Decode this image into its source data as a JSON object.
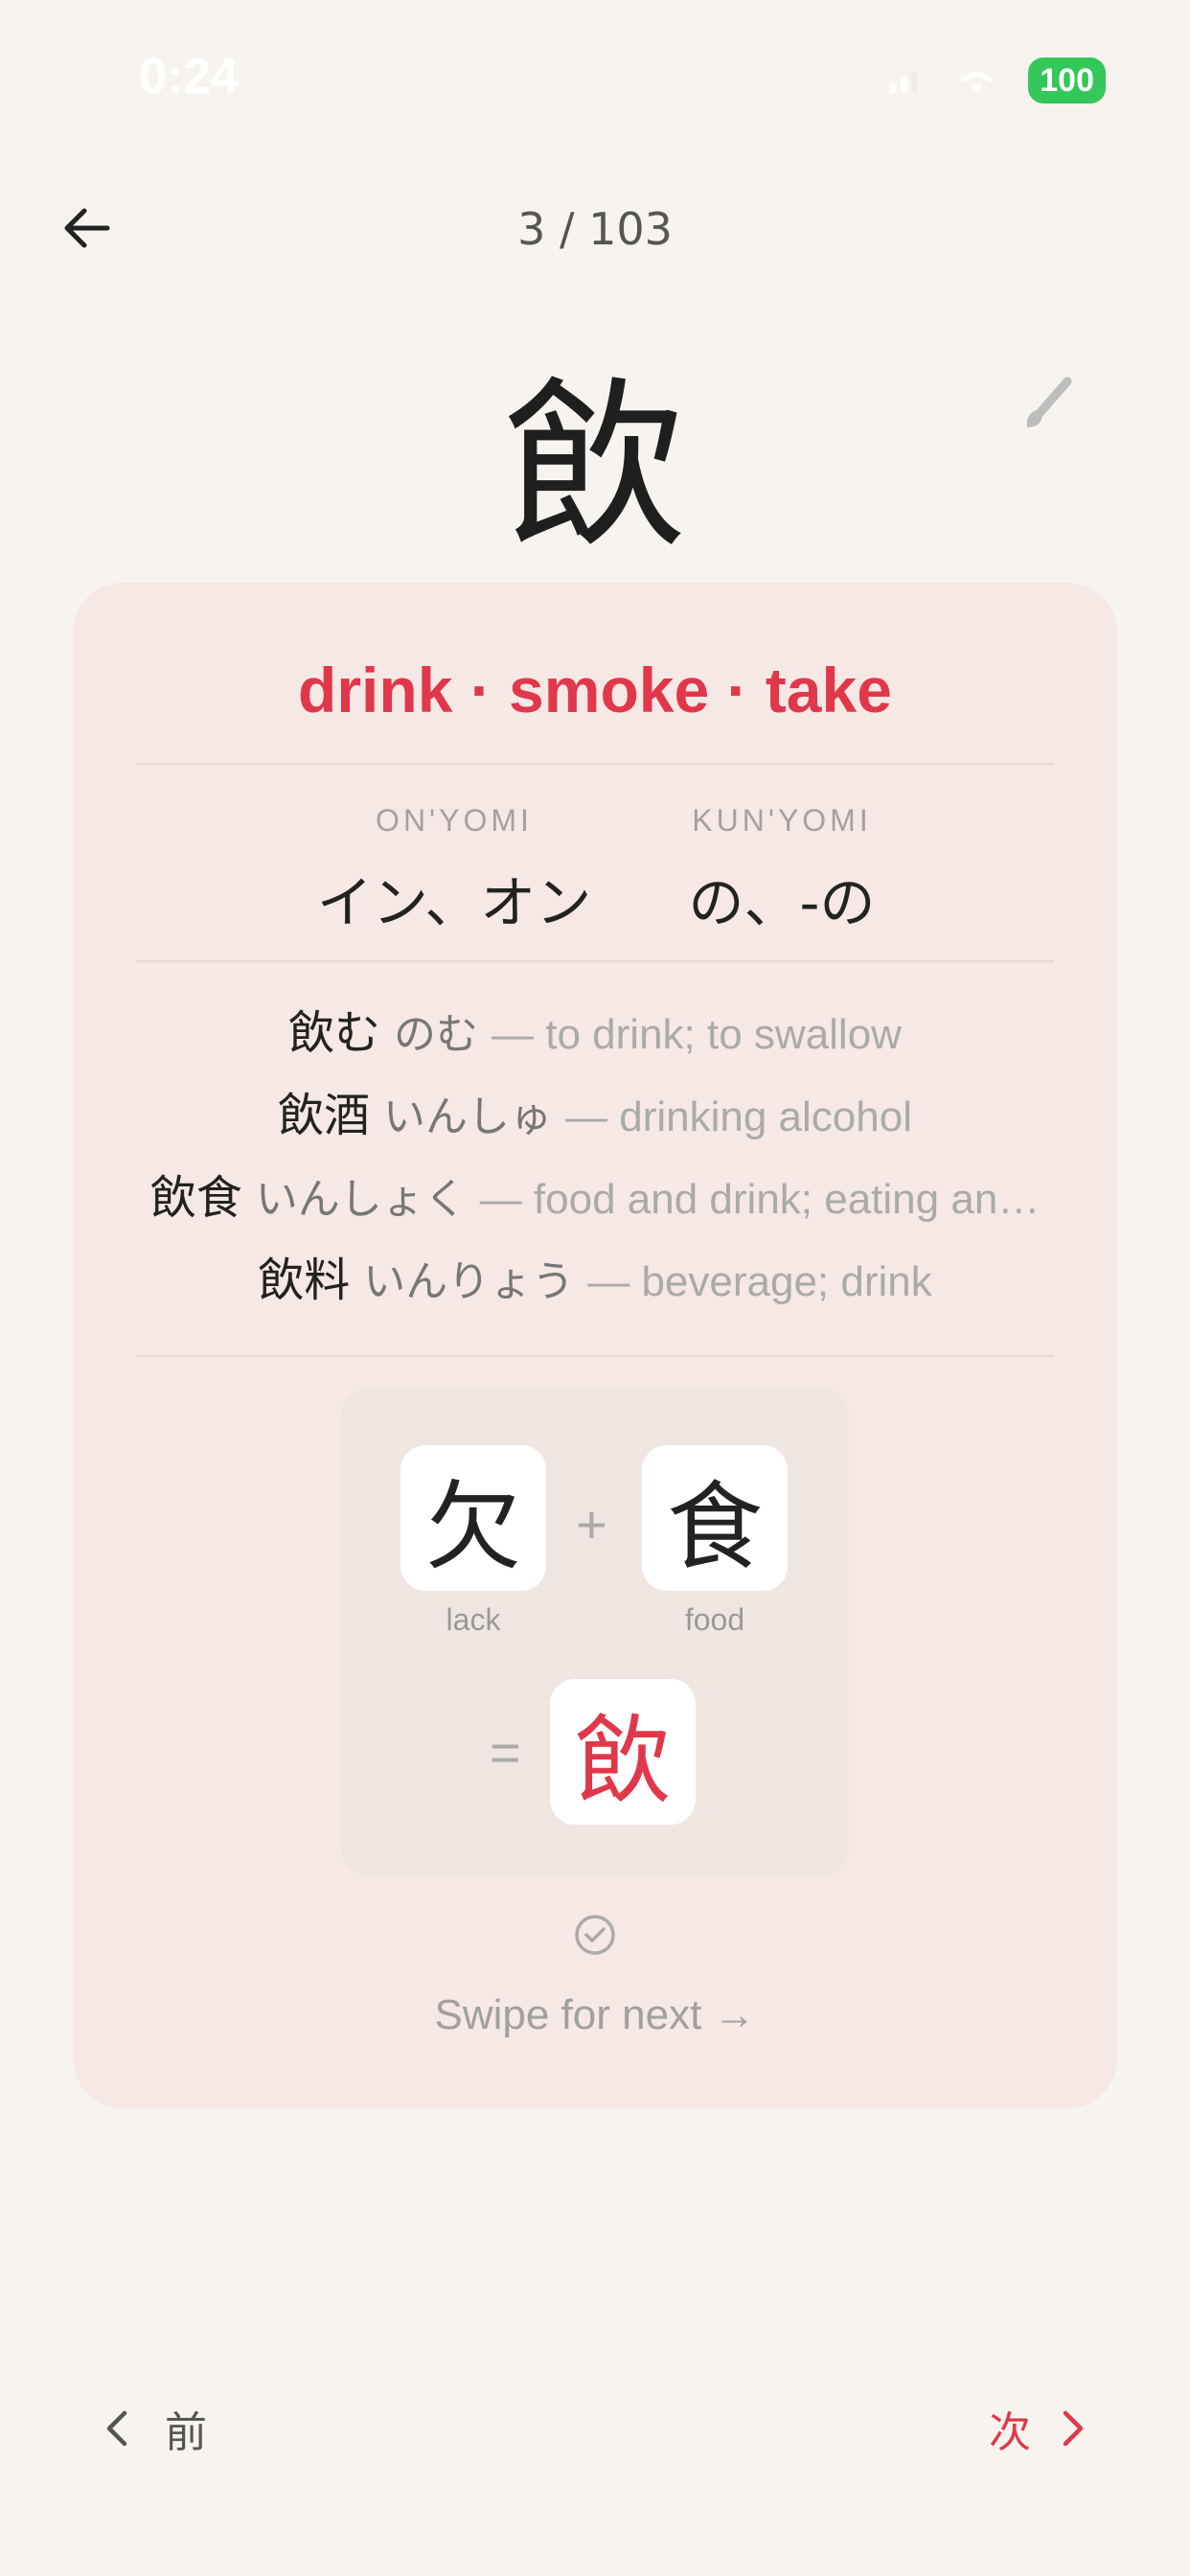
{
  "status": {
    "time": "0:24",
    "battery": "100"
  },
  "header": {
    "progress": "3 / 103"
  },
  "kanji": {
    "character": "飲",
    "meanings": "drink · smoke · take"
  },
  "readings": [
    {
      "label": "ON'YOMI",
      "value": "イン、オン"
    },
    {
      "label": "KUN'YOMI",
      "value": "の、-の"
    }
  ],
  "vocab": [
    {
      "word": "飲む",
      "reading": "のむ",
      "meaning": "— to drink; to swallow"
    },
    {
      "word": "飲酒",
      "reading": "いんしゅ",
      "meaning": "— drinking alcohol"
    },
    {
      "word": "飲食",
      "reading": "いんしょく",
      "meaning": "— food and drink; eating an…"
    },
    {
      "word": "飲料",
      "reading": "いんりょう",
      "meaning": "— beverage; drink"
    }
  ],
  "components": {
    "parts": [
      {
        "char": "欠",
        "label": "lack"
      },
      {
        "char": "食",
        "label": "food"
      }
    ],
    "plus": "+",
    "equals": "=",
    "result": "飲"
  },
  "footer": {
    "swipe_hint": "Swipe for next →"
  },
  "nav": {
    "prev_label": "前",
    "next_label": "次"
  },
  "colors": {
    "accent": "#e0384a",
    "card": "#f5e8e5",
    "background": "#f7f4ef"
  }
}
